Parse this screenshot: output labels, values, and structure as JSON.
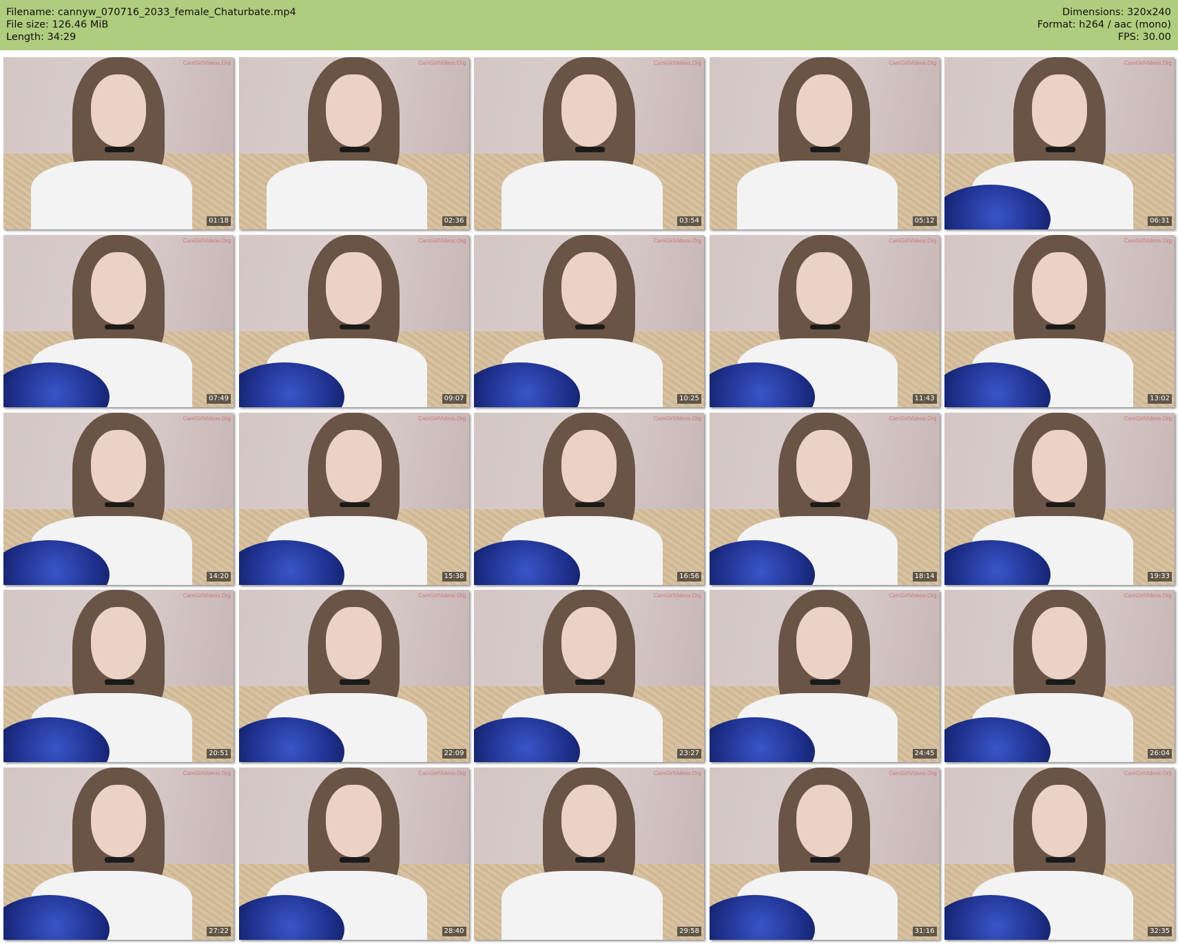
{
  "header": {
    "filename_line": "Filename: cannyw_070716_2033_female_Chaturbate.mp4",
    "filesize_line": "File size: 126.46 MiB",
    "length_line": "Length: 34:29",
    "dimensions_line": "Dimensions: 320x240",
    "format_line": "Format: h264 / aac (mono)",
    "fps_line": "FPS: 30.00",
    "background_color": "#b0cc7e"
  },
  "watermark_text": "CamGirlVideos.Org",
  "thumbnails": [
    {
      "timestamp": "01:18",
      "guitar": false
    },
    {
      "timestamp": "02:36",
      "guitar": false
    },
    {
      "timestamp": "03:54",
      "guitar": false
    },
    {
      "timestamp": "05:12",
      "guitar": false
    },
    {
      "timestamp": "06:31",
      "guitar": true
    },
    {
      "timestamp": "07:49",
      "guitar": true
    },
    {
      "timestamp": "09:07",
      "guitar": true
    },
    {
      "timestamp": "10:25",
      "guitar": true
    },
    {
      "timestamp": "11:43",
      "guitar": true
    },
    {
      "timestamp": "13:02",
      "guitar": true
    },
    {
      "timestamp": "14:20",
      "guitar": true
    },
    {
      "timestamp": "15:38",
      "guitar": true
    },
    {
      "timestamp": "16:56",
      "guitar": true
    },
    {
      "timestamp": "18:14",
      "guitar": true
    },
    {
      "timestamp": "19:33",
      "guitar": true
    },
    {
      "timestamp": "20:51",
      "guitar": true
    },
    {
      "timestamp": "22:09",
      "guitar": true
    },
    {
      "timestamp": "23:27",
      "guitar": true
    },
    {
      "timestamp": "24:45",
      "guitar": true
    },
    {
      "timestamp": "26:04",
      "guitar": true
    },
    {
      "timestamp": "27:22",
      "guitar": true
    },
    {
      "timestamp": "28:40",
      "guitar": true
    },
    {
      "timestamp": "29:58",
      "guitar": false
    },
    {
      "timestamp": "31:16",
      "guitar": true
    },
    {
      "timestamp": "32:35",
      "guitar": true
    }
  ]
}
